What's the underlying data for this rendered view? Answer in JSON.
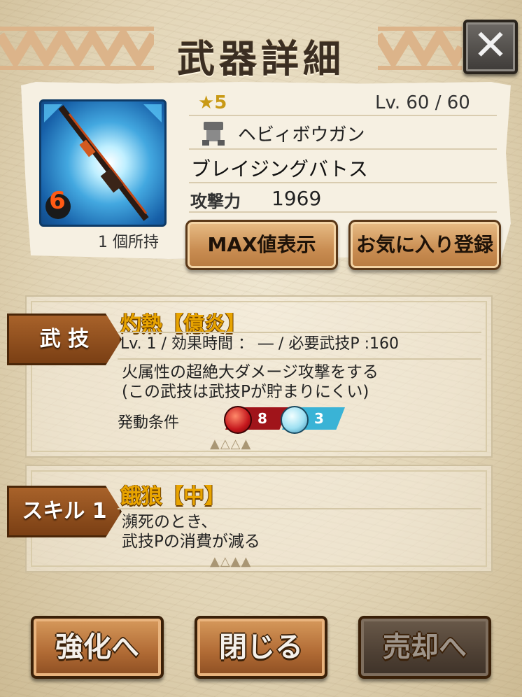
{
  "title": "武器詳細",
  "close_label": "✕",
  "weapon": {
    "rarity": "★5",
    "level": "Lv.  60 / 60",
    "type": "ヘビィボウガン",
    "type_icon": "heavy-bowgun-icon",
    "name": "ブレイジングバトス",
    "attack_label": "攻撃力",
    "attack_value": "1969",
    "hold_count": "1 個所持",
    "element_badge": "6"
  },
  "buttons": {
    "max_display": "MAX値表示",
    "favorite": "お気に入り登録"
  },
  "skill_arts": {
    "tab_label": "武 技",
    "name": "灼熱【億炎】",
    "stats": "Lv.   1 / 効果時間 ：  ― / 必要武技P  :160",
    "desc_line1": "火属性の超絶大ダメージ攻撃をする",
    "desc_line2": "(この武技は武技Pが貯まりにくい)",
    "condition_label": "発動条件",
    "fire_count": "8",
    "water_count": "3"
  },
  "skill1": {
    "tab_label": "スキル 1",
    "name": "餓狼【中】",
    "desc_line1": "瀕死のとき、",
    "desc_line2": "武技Pの消費が減る"
  },
  "bottom": {
    "enhance": "強化へ",
    "close": "閉じる",
    "sell": "売却へ"
  },
  "colors": {
    "accent_gold": "#e8a400",
    "wood": "#b77a40",
    "parchment": "#efe6d0"
  }
}
